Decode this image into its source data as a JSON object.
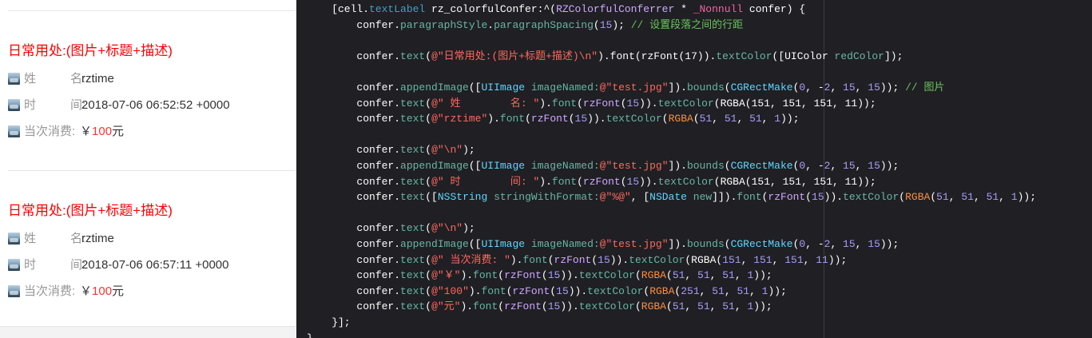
{
  "cells": [
    {
      "title": "日常用处:(图片+标题+描述)",
      "name_label": "姓",
      "name_label_2": "名:",
      "name_value": "rztime",
      "time_label": "时",
      "time_label_2": "间:",
      "time_value": "2018-07-06 06:52:52 +0000",
      "cost_label": "当次消费:",
      "currency": "￥",
      "amount": "100",
      "unit": "元"
    },
    {
      "title": "日常用处:(图片+标题+描述)",
      "name_label": "姓",
      "name_label_2": "名:",
      "name_value": "rztime",
      "time_label": "时",
      "time_label_2": "间:",
      "time_value": "2018-07-06 06:57:11 +0000",
      "cost_label": "当次消费:",
      "currency": "￥",
      "amount": "100",
      "unit": "元"
    }
  ],
  "code_lines": [
    [
      [
        "    [cell.",
        "t-plain"
      ],
      [
        "textLabel",
        "t-prop"
      ],
      [
        " rz_colorfulConfer:^(",
        "t-plain"
      ],
      [
        "RZColorfulConferrer",
        "t-type"
      ],
      [
        " * ",
        "t-plain"
      ],
      [
        "_Nonnull",
        "t-kw"
      ],
      [
        " confer) {",
        "t-plain"
      ]
    ],
    [
      [
        "        confer.",
        "t-plain"
      ],
      [
        "paragraphStyle",
        "t-method"
      ],
      [
        ".",
        "t-plain"
      ],
      [
        "paragraphSpacing",
        "t-method"
      ],
      [
        "(",
        "t-plain"
      ],
      [
        "15",
        "t-num"
      ],
      [
        "); ",
        "t-plain"
      ],
      [
        "// 设置段落之间的行距",
        "t-com"
      ]
    ],
    [],
    [
      [
        "        confer.",
        "t-plain"
      ],
      [
        "text",
        "t-method"
      ],
      [
        "(",
        "t-plain"
      ],
      [
        "@\"日常用处:(图片+标题+描述)\\n\"",
        "t-str"
      ],
      [
        ").font(rzFont(17)).",
        "t-plain"
      ],
      [
        "textColor",
        "t-method"
      ],
      [
        "([UIColor ",
        "t-plain"
      ],
      [
        "redColor",
        "t-method"
      ],
      [
        "]);",
        "t-plain"
      ]
    ],
    [],
    [
      [
        "        confer.",
        "t-plain"
      ],
      [
        "appendImage",
        "t-method"
      ],
      [
        "([",
        "t-plain"
      ],
      [
        "UIImage",
        "t-cls"
      ],
      [
        " ",
        "t-plain"
      ],
      [
        "imageNamed:",
        "t-method"
      ],
      [
        "@\"test.jpg\"",
        "t-str"
      ],
      [
        "]).",
        "t-plain"
      ],
      [
        "bounds",
        "t-method"
      ],
      [
        "(",
        "t-plain"
      ],
      [
        "CGRectMake",
        "t-cls"
      ],
      [
        "(",
        "t-plain"
      ],
      [
        "0",
        "t-num"
      ],
      [
        ", -",
        "t-plain"
      ],
      [
        "2",
        "t-num"
      ],
      [
        ", ",
        "t-plain"
      ],
      [
        "15",
        "t-num"
      ],
      [
        ", ",
        "t-plain"
      ],
      [
        "15",
        "t-num"
      ],
      [
        ")); ",
        "t-plain"
      ],
      [
        "// 图片",
        "t-com"
      ]
    ],
    [
      [
        "        confer.",
        "t-plain"
      ],
      [
        "text",
        "t-method"
      ],
      [
        "(",
        "t-plain"
      ],
      [
        "@\" 姓        名: \"",
        "t-str"
      ],
      [
        ").",
        "t-plain"
      ],
      [
        "font",
        "t-method"
      ],
      [
        "(",
        "t-plain"
      ],
      [
        "rzFont",
        "t-type"
      ],
      [
        "(",
        "t-plain"
      ],
      [
        "15",
        "t-num"
      ],
      [
        ")).",
        "t-plain"
      ],
      [
        "textColor",
        "t-method"
      ],
      [
        "(RGBA(151, 151, 151, 11));",
        "t-plain"
      ]
    ],
    [
      [
        "        confer.",
        "t-plain"
      ],
      [
        "text",
        "t-method"
      ],
      [
        "(",
        "t-plain"
      ],
      [
        "@\"rztime\"",
        "t-str"
      ],
      [
        ").",
        "t-plain"
      ],
      [
        "font",
        "t-method"
      ],
      [
        "(",
        "t-plain"
      ],
      [
        "rzFont",
        "t-type"
      ],
      [
        "(",
        "t-plain"
      ],
      [
        "15",
        "t-num"
      ],
      [
        ")).",
        "t-plain"
      ],
      [
        "textColor",
        "t-method"
      ],
      [
        "(",
        "t-plain"
      ],
      [
        "RGBA",
        "t-macro"
      ],
      [
        "(",
        "t-plain"
      ],
      [
        "51",
        "t-num"
      ],
      [
        ", ",
        "t-plain"
      ],
      [
        "51",
        "t-num"
      ],
      [
        ", ",
        "t-plain"
      ],
      [
        "51",
        "t-num"
      ],
      [
        ", ",
        "t-plain"
      ],
      [
        "1",
        "t-num"
      ],
      [
        "));",
        "t-plain"
      ]
    ],
    [],
    [
      [
        "        confer.",
        "t-plain"
      ],
      [
        "text",
        "t-method"
      ],
      [
        "(",
        "t-plain"
      ],
      [
        "@\"\\n\"",
        "t-str"
      ],
      [
        ");",
        "t-plain"
      ]
    ],
    [
      [
        "        confer.",
        "t-plain"
      ],
      [
        "appendImage",
        "t-method"
      ],
      [
        "([",
        "t-plain"
      ],
      [
        "UIImage",
        "t-cls"
      ],
      [
        " ",
        "t-plain"
      ],
      [
        "imageNamed:",
        "t-method"
      ],
      [
        "@\"test.jpg\"",
        "t-str"
      ],
      [
        "]).",
        "t-plain"
      ],
      [
        "bounds",
        "t-method"
      ],
      [
        "(",
        "t-plain"
      ],
      [
        "CGRectMake",
        "t-cls"
      ],
      [
        "(",
        "t-plain"
      ],
      [
        "0",
        "t-num"
      ],
      [
        ", -",
        "t-plain"
      ],
      [
        "2",
        "t-num"
      ],
      [
        ", ",
        "t-plain"
      ],
      [
        "15",
        "t-num"
      ],
      [
        ", ",
        "t-plain"
      ],
      [
        "15",
        "t-num"
      ],
      [
        "));",
        "t-plain"
      ]
    ],
    [
      [
        "        confer.",
        "t-plain"
      ],
      [
        "text",
        "t-method"
      ],
      [
        "(",
        "t-plain"
      ],
      [
        "@\" 时        间: \"",
        "t-str"
      ],
      [
        ").",
        "t-plain"
      ],
      [
        "font",
        "t-method"
      ],
      [
        "(",
        "t-plain"
      ],
      [
        "rzFont",
        "t-type"
      ],
      [
        "(",
        "t-plain"
      ],
      [
        "15",
        "t-num"
      ],
      [
        ")).",
        "t-plain"
      ],
      [
        "textColor",
        "t-method"
      ],
      [
        "(RGBA(151, 151, 151, 11));",
        "t-plain"
      ]
    ],
    [
      [
        "        confer.",
        "t-plain"
      ],
      [
        "text",
        "t-method"
      ],
      [
        "([",
        "t-plain"
      ],
      [
        "NSString",
        "t-cls"
      ],
      [
        " ",
        "t-plain"
      ],
      [
        "stringWithFormat:",
        "t-method"
      ],
      [
        "@\"%@\"",
        "t-str"
      ],
      [
        ", [",
        "t-plain"
      ],
      [
        "NSDate",
        "t-cls"
      ],
      [
        " ",
        "t-plain"
      ],
      [
        "new",
        "t-method"
      ],
      [
        "]]).",
        "t-plain"
      ],
      [
        "font",
        "t-method"
      ],
      [
        "(",
        "t-plain"
      ],
      [
        "rzFont",
        "t-type"
      ],
      [
        "(",
        "t-plain"
      ],
      [
        "15",
        "t-num"
      ],
      [
        ")).",
        "t-plain"
      ],
      [
        "textColor",
        "t-method"
      ],
      [
        "(",
        "t-plain"
      ],
      [
        "RGBA",
        "t-macro"
      ],
      [
        "(",
        "t-plain"
      ],
      [
        "51",
        "t-num"
      ],
      [
        ", ",
        "t-plain"
      ],
      [
        "51",
        "t-num"
      ],
      [
        ", ",
        "t-plain"
      ],
      [
        "51",
        "t-num"
      ],
      [
        ", ",
        "t-plain"
      ],
      [
        "1",
        "t-num"
      ],
      [
        "));",
        "t-plain"
      ]
    ],
    [],
    [
      [
        "        confer.",
        "t-plain"
      ],
      [
        "text",
        "t-method"
      ],
      [
        "(",
        "t-plain"
      ],
      [
        "@\"\\n\"",
        "t-str"
      ],
      [
        ");",
        "t-plain"
      ]
    ],
    [
      [
        "        confer.",
        "t-plain"
      ],
      [
        "appendImage",
        "t-method"
      ],
      [
        "([",
        "t-plain"
      ],
      [
        "UIImage",
        "t-cls"
      ],
      [
        " ",
        "t-plain"
      ],
      [
        "imageNamed:",
        "t-method"
      ],
      [
        "@\"test.jpg\"",
        "t-str"
      ],
      [
        "]).",
        "t-plain"
      ],
      [
        "bounds",
        "t-method"
      ],
      [
        "(",
        "t-plain"
      ],
      [
        "CGRectMake",
        "t-cls"
      ],
      [
        "(",
        "t-plain"
      ],
      [
        "0",
        "t-num"
      ],
      [
        ", -",
        "t-plain"
      ],
      [
        "2",
        "t-num"
      ],
      [
        ", ",
        "t-plain"
      ],
      [
        "15",
        "t-num"
      ],
      [
        ", ",
        "t-plain"
      ],
      [
        "15",
        "t-num"
      ],
      [
        "));",
        "t-plain"
      ]
    ],
    [
      [
        "        confer.",
        "t-plain"
      ],
      [
        "text",
        "t-method"
      ],
      [
        "(",
        "t-plain"
      ],
      [
        "@\" 当次消费: \"",
        "t-str"
      ],
      [
        ").",
        "t-plain"
      ],
      [
        "font",
        "t-method"
      ],
      [
        "(",
        "t-plain"
      ],
      [
        "rzFont",
        "t-type"
      ],
      [
        "(",
        "t-plain"
      ],
      [
        "15",
        "t-num"
      ],
      [
        ")).",
        "t-plain"
      ],
      [
        "textColor",
        "t-method"
      ],
      [
        "(RGBA(",
        "t-plain"
      ],
      [
        "151",
        "t-num"
      ],
      [
        ", ",
        "t-plain"
      ],
      [
        "151",
        "t-num"
      ],
      [
        ", ",
        "t-plain"
      ],
      [
        "151",
        "t-num"
      ],
      [
        ", ",
        "t-plain"
      ],
      [
        "11",
        "t-num"
      ],
      [
        "));",
        "t-plain"
      ]
    ],
    [
      [
        "        confer.",
        "t-plain"
      ],
      [
        "text",
        "t-method"
      ],
      [
        "(",
        "t-plain"
      ],
      [
        "@\"￥\"",
        "t-str"
      ],
      [
        ").",
        "t-plain"
      ],
      [
        "font",
        "t-method"
      ],
      [
        "(",
        "t-plain"
      ],
      [
        "rzFont",
        "t-type"
      ],
      [
        "(",
        "t-plain"
      ],
      [
        "15",
        "t-num"
      ],
      [
        ")).",
        "t-plain"
      ],
      [
        "textColor",
        "t-method"
      ],
      [
        "(",
        "t-plain"
      ],
      [
        "RGBA",
        "t-macro"
      ],
      [
        "(",
        "t-plain"
      ],
      [
        "51",
        "t-num"
      ],
      [
        ", ",
        "t-plain"
      ],
      [
        "51",
        "t-num"
      ],
      [
        ", ",
        "t-plain"
      ],
      [
        "51",
        "t-num"
      ],
      [
        ", ",
        "t-plain"
      ],
      [
        "1",
        "t-num"
      ],
      [
        "));",
        "t-plain"
      ]
    ],
    [
      [
        "        confer.",
        "t-plain"
      ],
      [
        "text",
        "t-method"
      ],
      [
        "(",
        "t-plain"
      ],
      [
        "@\"100\"",
        "t-str"
      ],
      [
        ").",
        "t-plain"
      ],
      [
        "font",
        "t-method"
      ],
      [
        "(",
        "t-plain"
      ],
      [
        "rzFont",
        "t-type"
      ],
      [
        "(",
        "t-plain"
      ],
      [
        "15",
        "t-num"
      ],
      [
        ")).",
        "t-plain"
      ],
      [
        "textColor",
        "t-method"
      ],
      [
        "(",
        "t-plain"
      ],
      [
        "RGBA",
        "t-macro"
      ],
      [
        "(",
        "t-plain"
      ],
      [
        "251",
        "t-num"
      ],
      [
        ", ",
        "t-plain"
      ],
      [
        "51",
        "t-num"
      ],
      [
        ", ",
        "t-plain"
      ],
      [
        "51",
        "t-num"
      ],
      [
        ", ",
        "t-plain"
      ],
      [
        "1",
        "t-num"
      ],
      [
        "));",
        "t-plain"
      ]
    ],
    [
      [
        "        confer.",
        "t-plain"
      ],
      [
        "text",
        "t-method"
      ],
      [
        "(",
        "t-plain"
      ],
      [
        "@\"元\"",
        "t-str"
      ],
      [
        ").",
        "t-plain"
      ],
      [
        "font",
        "t-method"
      ],
      [
        "(",
        "t-plain"
      ],
      [
        "rzFont",
        "t-type"
      ],
      [
        "(",
        "t-plain"
      ],
      [
        "15",
        "t-num"
      ],
      [
        ")).",
        "t-plain"
      ],
      [
        "textColor",
        "t-method"
      ],
      [
        "(",
        "t-plain"
      ],
      [
        "RGBA",
        "t-macro"
      ],
      [
        "(",
        "t-plain"
      ],
      [
        "51",
        "t-num"
      ],
      [
        ", ",
        "t-plain"
      ],
      [
        "51",
        "t-num"
      ],
      [
        ", ",
        "t-plain"
      ],
      [
        "51",
        "t-num"
      ],
      [
        ", ",
        "t-plain"
      ],
      [
        "1",
        "t-num"
      ],
      [
        "));",
        "t-plain"
      ]
    ],
    [
      [
        "    }];",
        "t-plain"
      ]
    ],
    [
      [
        "}",
        "t-plain"
      ]
    ]
  ]
}
